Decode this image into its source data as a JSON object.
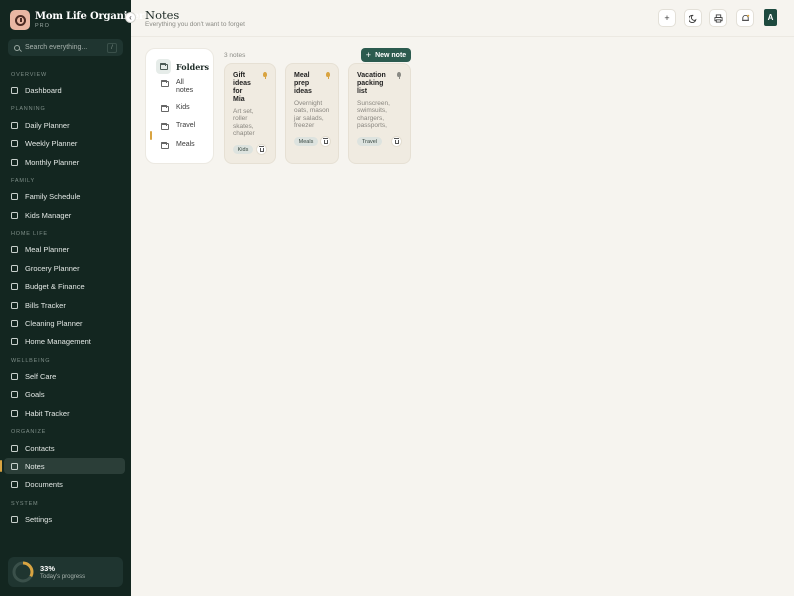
{
  "app": {
    "name": "Mom Life Organizer",
    "plan": "PRO"
  },
  "search": {
    "placeholder": "Search everything...",
    "shortcut": "/"
  },
  "nav": {
    "overview_label": "OVERVIEW",
    "dashboard": "Dashboard",
    "planning_label": "PLANNING",
    "daily": "Daily Planner",
    "weekly": "Weekly Planner",
    "monthly": "Monthly Planner",
    "family_label": "FAMILY",
    "family_schedule": "Family Schedule",
    "kids_manager": "Kids Manager",
    "home_label": "HOME LIFE",
    "meal_planner": "Meal Planner",
    "grocery": "Grocery Planner",
    "budget": "Budget & Finance",
    "bills": "Bills Tracker",
    "cleaning": "Cleaning Planner",
    "home_mgmt": "Home Management",
    "wellbeing_label": "WELLBEING",
    "self_care": "Self Care",
    "goals": "Goals",
    "habit": "Habit Tracker",
    "organize_label": "ORGANIZE",
    "contacts": "Contacts",
    "notes": "Notes",
    "documents": "Documents",
    "system_label": "SYSTEM",
    "settings": "Settings"
  },
  "progress": {
    "value": "33%",
    "fraction": 0.33,
    "label": "Today's progress"
  },
  "header": {
    "title": "Notes",
    "subtitle": "Everything you don't want to forget",
    "avatar": "A"
  },
  "folders": {
    "title": "Folders",
    "items": {
      "all_1": "All",
      "all_2": "notes",
      "kids": "Kids",
      "travel": "Travel",
      "meals": "Meals"
    }
  },
  "notes_count": "3 notes",
  "new_note": "New note",
  "notes": [
    {
      "title": [
        "Gift",
        "ideas",
        "for",
        "Mia"
      ],
      "body": [
        "Art set,",
        "roller",
        "skates,",
        "chapter"
      ],
      "tag": "Kids",
      "pin_color": "#d9a441"
    },
    {
      "title": [
        "Meal",
        "prep",
        "ideas"
      ],
      "body": [
        "Overnight",
        "oats, mason",
        "jar salads,",
        "freezer"
      ],
      "tag": "Meals",
      "pin_color": "#d9a441"
    },
    {
      "title": [
        "Vacation",
        "packing",
        "list"
      ],
      "body": [
        "Sunscreen,",
        "swimsuits,",
        "chargers,",
        "passports,"
      ],
      "tag": "Travel",
      "pin_color": "#8a8a84"
    }
  ],
  "colors": {
    "sidebar": "#132620",
    "accent": "#2c5b4f",
    "highlight": "#d9a441",
    "background": "#f6f4ef"
  }
}
